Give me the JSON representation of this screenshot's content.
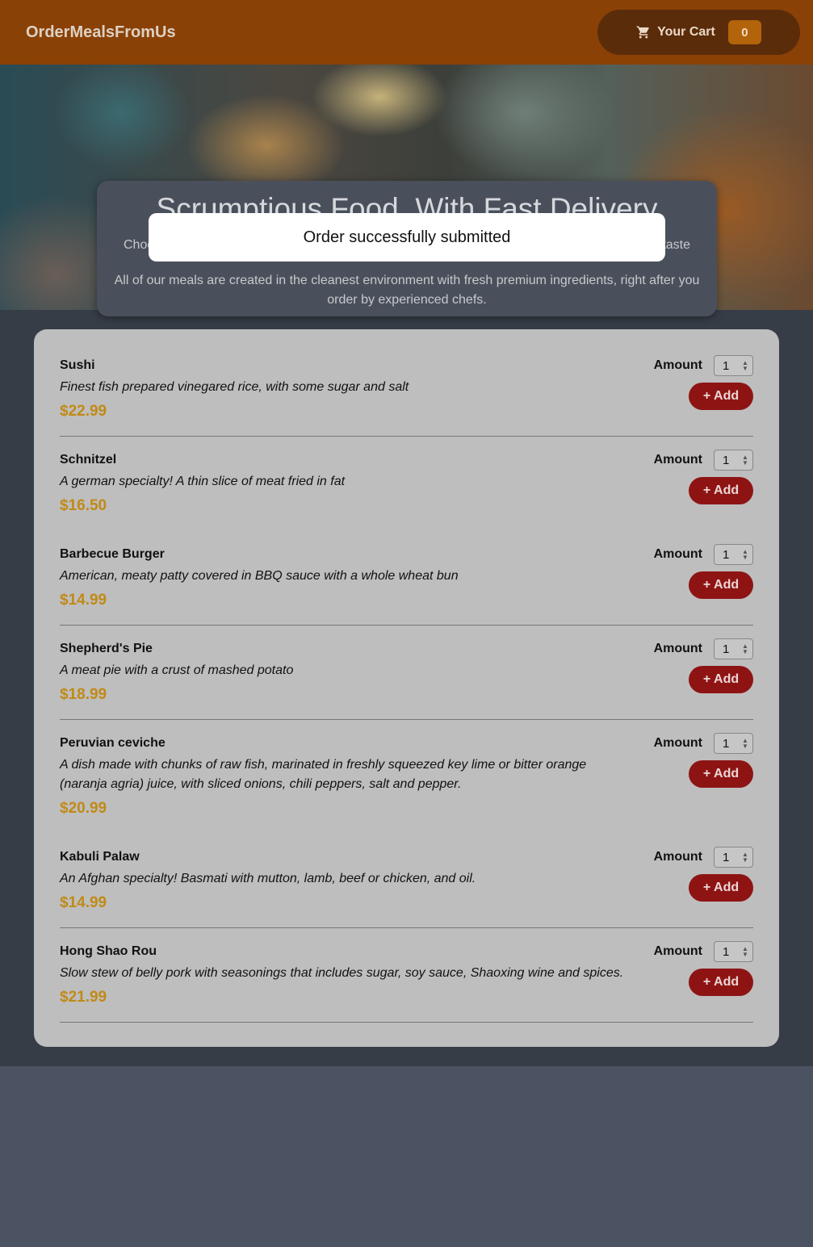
{
  "header": {
    "logo": "OrderMealsFromUs",
    "cart_label": "Your Cart",
    "cart_count": "0",
    "cart_icon": "cart-icon"
  },
  "summary": {
    "title": "Scrumptious Food, With Fast Delivery",
    "line1_start": "Choo",
    "line1_end": "taste",
    "line2": "All of our meals are created in the cleanest environment with fresh premium ingredients, right after you order by experienced chefs."
  },
  "toast": {
    "message": "Order successfully submitted"
  },
  "meals": [
    {
      "name": "Sushi",
      "description": "Finest fish prepared vinegared rice, with some sugar and salt",
      "price": "$22.99",
      "amount_label": "Amount",
      "amount": "1",
      "add_label": "+ Add"
    },
    {
      "name": "Schnitzel",
      "description": "A german specialty! A thin slice of meat fried in fat",
      "price": "$16.50",
      "amount_label": "Amount",
      "amount": "1",
      "add_label": "+ Add"
    },
    {
      "name": "Barbecue Burger",
      "description": "American, meaty patty covered in BBQ sauce with a whole wheat bun",
      "price": "$14.99",
      "amount_label": "Amount",
      "amount": "1",
      "add_label": "+ Add"
    },
    {
      "name": "Shepherd's Pie",
      "description": "A meat pie with a crust of mashed potato",
      "price": "$18.99",
      "amount_label": "Amount",
      "amount": "1",
      "add_label": "+ Add"
    },
    {
      "name": "Peruvian ceviche",
      "description": "A dish made with chunks of raw fish, marinated in freshly squeezed key lime or bitter orange (naranja agria) juice, with sliced onions, chili peppers, salt and pepper.",
      "price": "$20.99",
      "amount_label": "Amount",
      "amount": "1",
      "add_label": "+ Add"
    },
    {
      "name": "Kabuli Palaw",
      "description": "An Afghan specialty! Basmati with mutton, lamb, beef or chicken, and oil.",
      "price": "$14.99",
      "amount_label": "Amount",
      "amount": "1",
      "add_label": "+ Add"
    },
    {
      "name": "Hong Shao Rou",
      "description": "Slow stew of belly pork with seasonings that includes sugar, soy sauce, Shaoxing wine and spices.",
      "price": "$21.99",
      "amount_label": "Amount",
      "amount": "1",
      "add_label": "+ Add"
    }
  ]
}
